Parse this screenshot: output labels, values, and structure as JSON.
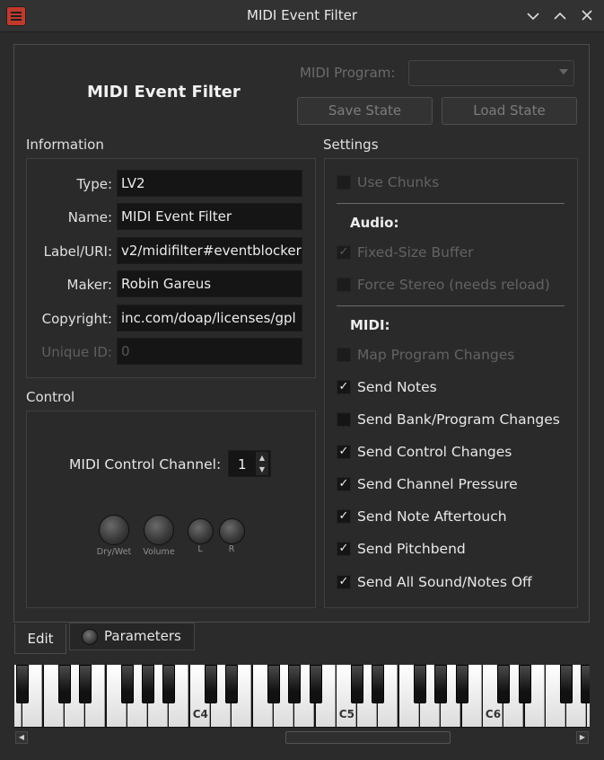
{
  "window": {
    "title": "MIDI Event Filter"
  },
  "header": {
    "plugin_name": "MIDI Event Filter",
    "midi_program_label": "MIDI Program:",
    "midi_program_value": "",
    "save_state_label": "Save State",
    "load_state_label": "Load State"
  },
  "information": {
    "heading": "Information",
    "rows": [
      {
        "label": "Type:",
        "value": "LV2",
        "enabled": true
      },
      {
        "label": "Name:",
        "value": "MIDI Event Filter",
        "enabled": true
      },
      {
        "label": "Label/URI:",
        "value": "v2/midifilter#eventblocker",
        "enabled": true
      },
      {
        "label": "Maker:",
        "value": "Robin Gareus",
        "enabled": true
      },
      {
        "label": "Copyright:",
        "value": "inc.com/doap/licenses/gpl",
        "enabled": true
      },
      {
        "label": "Unique ID:",
        "value": "0",
        "enabled": false
      }
    ]
  },
  "control": {
    "heading": "Control",
    "channel_label": "MIDI Control Channel:",
    "channel_value": "1",
    "knobs": [
      {
        "label": "Dry/Wet"
      },
      {
        "label": "Volume"
      },
      {
        "label": "L"
      },
      {
        "label": "R"
      }
    ]
  },
  "settings": {
    "heading": "Settings",
    "use_chunks": {
      "label": "Use Chunks",
      "checked": false,
      "enabled": false
    },
    "audio_heading": "Audio:",
    "fixed_size_buffer": {
      "label": "Fixed-Size Buffer",
      "checked": true,
      "enabled": false
    },
    "force_stereo": {
      "label": "Force Stereo (needs reload)",
      "checked": false,
      "enabled": false
    },
    "midi_heading": "MIDI:",
    "midi_options": [
      {
        "label": "Map Program Changes",
        "checked": false,
        "enabled": false
      },
      {
        "label": "Send Notes",
        "checked": true,
        "enabled": true
      },
      {
        "label": "Send Bank/Program Changes",
        "checked": false,
        "enabled": true
      },
      {
        "label": "Send Control Changes",
        "checked": true,
        "enabled": true
      },
      {
        "label": "Send Channel Pressure",
        "checked": true,
        "enabled": true
      },
      {
        "label": "Send Note Aftertouch",
        "checked": true,
        "enabled": true
      },
      {
        "label": "Send Pitchbend",
        "checked": true,
        "enabled": true
      },
      {
        "label": "Send All Sound/Notes Off",
        "checked": true,
        "enabled": true
      }
    ]
  },
  "tabs": {
    "edit_label": "Edit",
    "parameters_label": "Parameters"
  },
  "keyboard": {
    "octave_labels": [
      "C4",
      "C5",
      "C6"
    ]
  },
  "icons": {
    "minimize": "chevron-down-icon",
    "maximize": "chevron-up-icon",
    "close": "close-icon",
    "checkmark": "✓"
  }
}
